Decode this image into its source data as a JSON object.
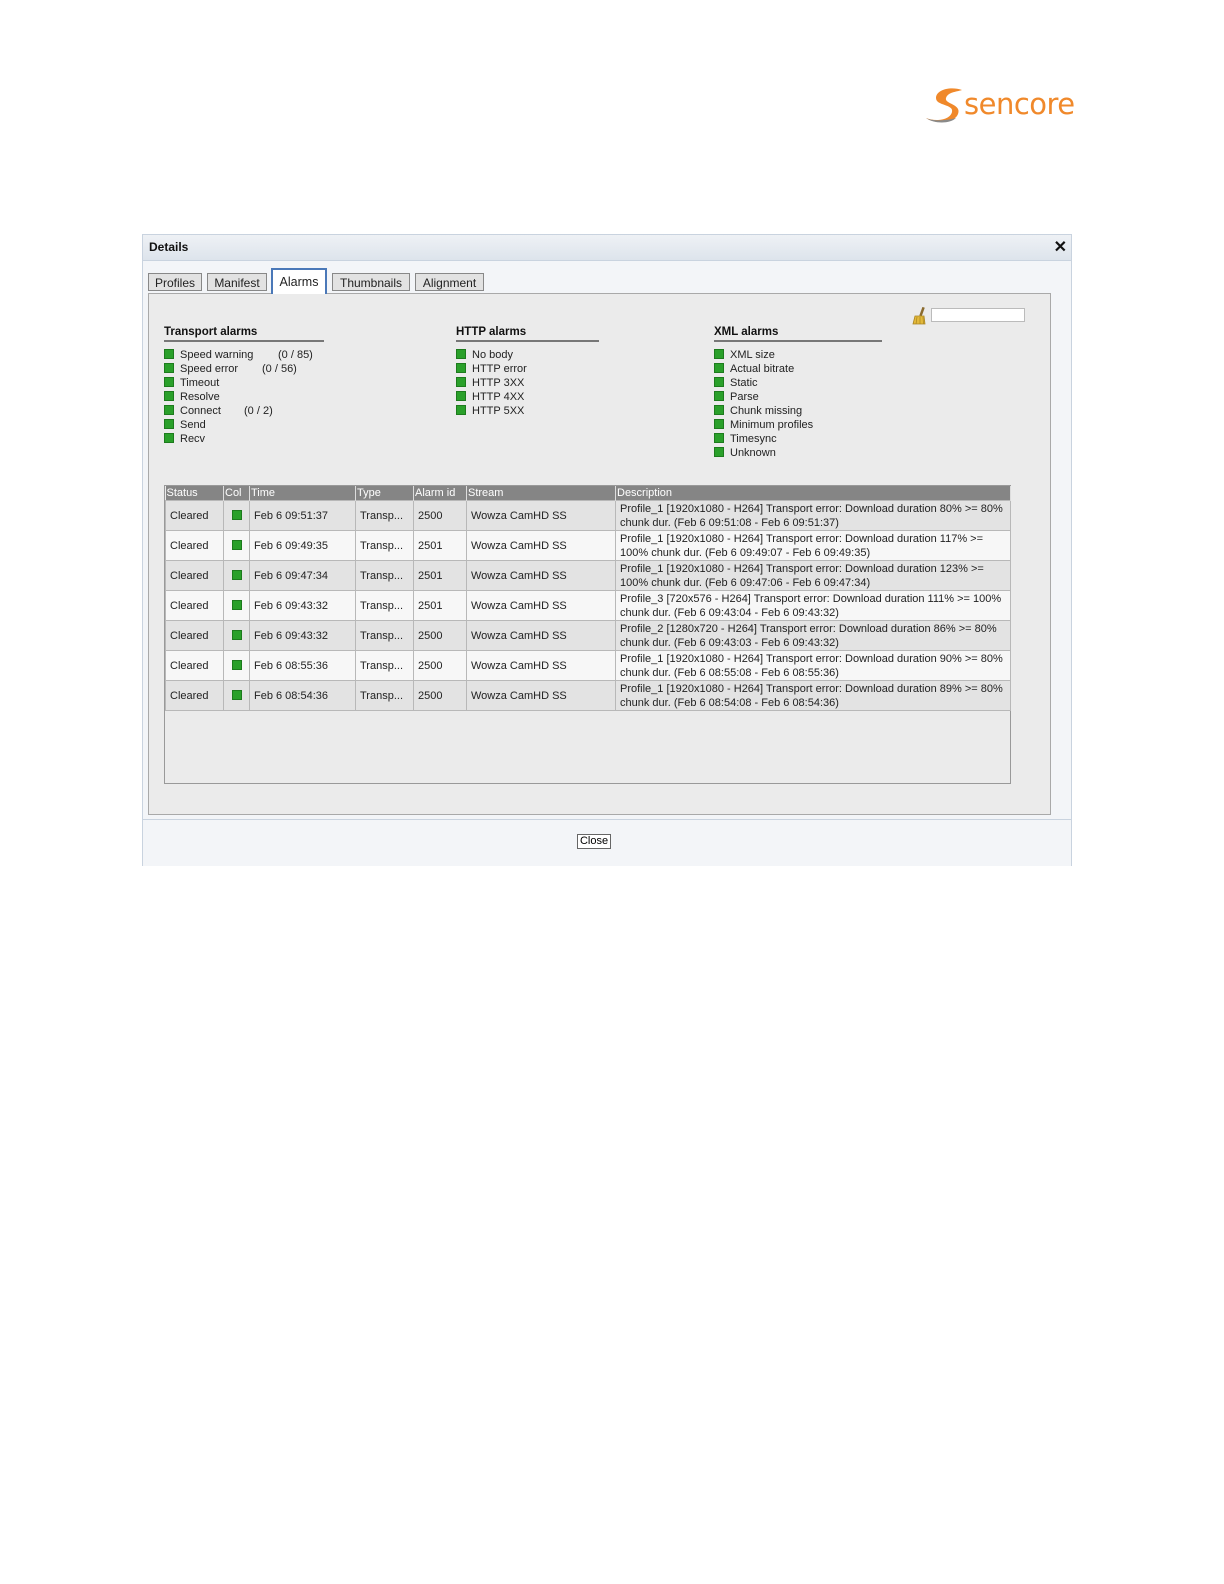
{
  "brand": {
    "logo_text": "sencore",
    "color": "#f0892b"
  },
  "dialog": {
    "title": "Details",
    "close_label": "Close"
  },
  "tabs": [
    {
      "label": "Profiles"
    },
    {
      "label": "Manifest"
    },
    {
      "label": "Alarms"
    },
    {
      "label": "Thumbnails"
    },
    {
      "label": "Alignment"
    }
  ],
  "filter": {
    "value": ""
  },
  "groups": {
    "transport": {
      "title": "Transport alarms",
      "items": [
        {
          "label": "Speed warning",
          "count": "(0 / 85)"
        },
        {
          "label": "Speed error",
          "count": "(0 / 56)"
        },
        {
          "label": "Timeout",
          "count": ""
        },
        {
          "label": "Resolve",
          "count": ""
        },
        {
          "label": "Connect",
          "count": "(0 / 2)"
        },
        {
          "label": "Send",
          "count": ""
        },
        {
          "label": "Recv",
          "count": ""
        }
      ]
    },
    "http": {
      "title": "HTTP alarms",
      "items": [
        {
          "label": "No body"
        },
        {
          "label": "HTTP error"
        },
        {
          "label": "HTTP 3XX"
        },
        {
          "label": "HTTP 4XX"
        },
        {
          "label": "HTTP 5XX"
        }
      ]
    },
    "xml": {
      "title": "XML alarms",
      "items": [
        {
          "label": "XML size"
        },
        {
          "label": "Actual bitrate"
        },
        {
          "label": "Static"
        },
        {
          "label": "Parse"
        },
        {
          "label": "Chunk missing"
        },
        {
          "label": "Minimum profiles"
        },
        {
          "label": "Timesync"
        },
        {
          "label": "Unknown"
        }
      ]
    }
  },
  "table": {
    "headers": [
      "Status",
      "Col",
      "Time",
      "Type",
      "Alarm id",
      "Stream",
      "Description"
    ],
    "rows": [
      {
        "status": "Cleared",
        "time": "Feb 6 09:51:37",
        "type": "Transp...",
        "alarm_id": "2500",
        "stream": "Wowza CamHD SS",
        "description": "Profile_1 [1920x1080 - H264] Transport error: Download duration 80% >= 80% chunk dur. (Feb 6 09:51:08 - Feb 6 09:51:37)"
      },
      {
        "status": "Cleared",
        "time": "Feb 6 09:49:35",
        "type": "Transp...",
        "alarm_id": "2501",
        "stream": "Wowza CamHD SS",
        "description": "Profile_1 [1920x1080 - H264] Transport error: Download duration 117% >= 100% chunk dur. (Feb 6 09:49:07 - Feb 6 09:49:35)"
      },
      {
        "status": "Cleared",
        "time": "Feb 6 09:47:34",
        "type": "Transp...",
        "alarm_id": "2501",
        "stream": "Wowza CamHD SS",
        "description": "Profile_1 [1920x1080 - H264] Transport error: Download duration 123% >= 100% chunk dur. (Feb 6 09:47:06 - Feb 6 09:47:34)"
      },
      {
        "status": "Cleared",
        "time": "Feb 6 09:43:32",
        "type": "Transp...",
        "alarm_id": "2501",
        "stream": "Wowza CamHD SS",
        "description": "Profile_3 [720x576 - H264] Transport error: Download duration 111% >= 100% chunk dur. (Feb 6 09:43:04 - Feb 6 09:43:32)"
      },
      {
        "status": "Cleared",
        "time": "Feb 6 09:43:32",
        "type": "Transp...",
        "alarm_id": "2500",
        "stream": "Wowza CamHD SS",
        "description": "Profile_2 [1280x720 - H264] Transport error: Download duration 86% >= 80% chunk dur. (Feb 6 09:43:03 - Feb 6 09:43:32)"
      },
      {
        "status": "Cleared",
        "time": "Feb 6 08:55:36",
        "type": "Transp...",
        "alarm_id": "2500",
        "stream": "Wowza CamHD SS",
        "description": "Profile_1 [1920x1080 - H264] Transport error: Download duration 90% >= 80% chunk dur. (Feb 6 08:55:08 - Feb 6 08:55:36)"
      },
      {
        "status": "Cleared",
        "time": "Feb 6 08:54:36",
        "type": "Transp...",
        "alarm_id": "2500",
        "stream": "Wowza CamHD SS",
        "description": "Profile_1 [1920x1080 - H264] Transport error: Download duration 89% >= 80% chunk dur. (Feb 6 08:54:08 - Feb 6 08:54:36)"
      }
    ]
  },
  "colors": {
    "ok_green": "#2aa02a",
    "active_tab_border": "#4a78b8",
    "header_gray": "#858585"
  }
}
